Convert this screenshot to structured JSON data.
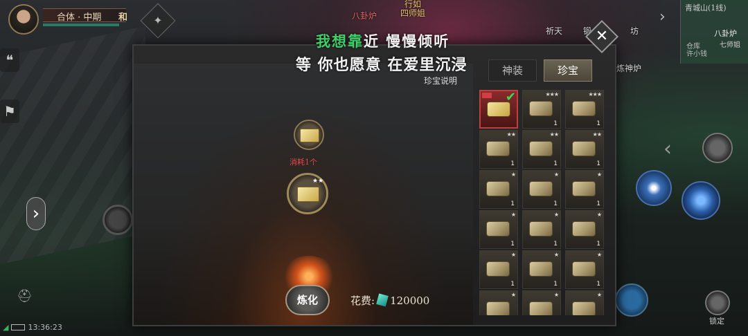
{
  "hud": {
    "realm": "合体 · 中期",
    "realm_extra": "和",
    "top_labels": [
      {
        "text": "行如",
        "color": "#e6c36a"
      },
      {
        "text": "八卦炉",
        "color": "#e06a6a"
      },
      {
        "text": "四师姐",
        "color": "#e6c36a"
      }
    ],
    "func_labels": [
      "祈天",
      "锻",
      "坊",
      "炼神炉"
    ],
    "minimap": {
      "title": "青城山(1线)",
      "point_a": "八卦炉",
      "point_b": "七师姐",
      "point_c": "仓库\n许小钱"
    },
    "time": "13:36:23",
    "lock_label": "锁定"
  },
  "dialog": {
    "lyric_line1_highlight": "我想靠",
    "lyric_line1_rest": "近 慢慢倾听",
    "lyric_line2": "等 你也愿意 在爱里沉浸",
    "tabs": [
      {
        "label": "神装",
        "active": false
      },
      {
        "label": "珍宝",
        "active": true
      }
    ],
    "treasure_note": "珍宝说明",
    "cost_consume": "消耗1个",
    "refine_button": "炼化",
    "cost_label": "花费:",
    "cost_value": "120000",
    "close_icon": "close-icon"
  },
  "inventory": [
    {
      "stars": "",
      "qty": "",
      "selected": true
    },
    {
      "stars": "★★★",
      "qty": "1",
      "selected": false
    },
    {
      "stars": "★★★",
      "qty": "1",
      "selected": false
    },
    {
      "stars": "★★",
      "qty": "1",
      "selected": false
    },
    {
      "stars": "★★",
      "qty": "1",
      "selected": false
    },
    {
      "stars": "★★",
      "qty": "1",
      "selected": false
    },
    {
      "stars": "★",
      "qty": "1",
      "selected": false
    },
    {
      "stars": "★",
      "qty": "1",
      "selected": false
    },
    {
      "stars": "★",
      "qty": "1",
      "selected": false
    },
    {
      "stars": "★",
      "qty": "1",
      "selected": false
    },
    {
      "stars": "★",
      "qty": "1",
      "selected": false
    },
    {
      "stars": "★",
      "qty": "1",
      "selected": false
    },
    {
      "stars": "★",
      "qty": "1",
      "selected": false
    },
    {
      "stars": "★",
      "qty": "1",
      "selected": false
    },
    {
      "stars": "★",
      "qty": "1",
      "selected": false
    },
    {
      "stars": "★",
      "qty": "",
      "selected": false
    },
    {
      "stars": "★",
      "qty": "",
      "selected": false
    },
    {
      "stars": "★",
      "qty": "",
      "selected": false
    }
  ],
  "colors": {
    "lyric_highlight": "#3ecf6a",
    "cost_red": "#e04848",
    "tab_active": "#6a6354"
  }
}
